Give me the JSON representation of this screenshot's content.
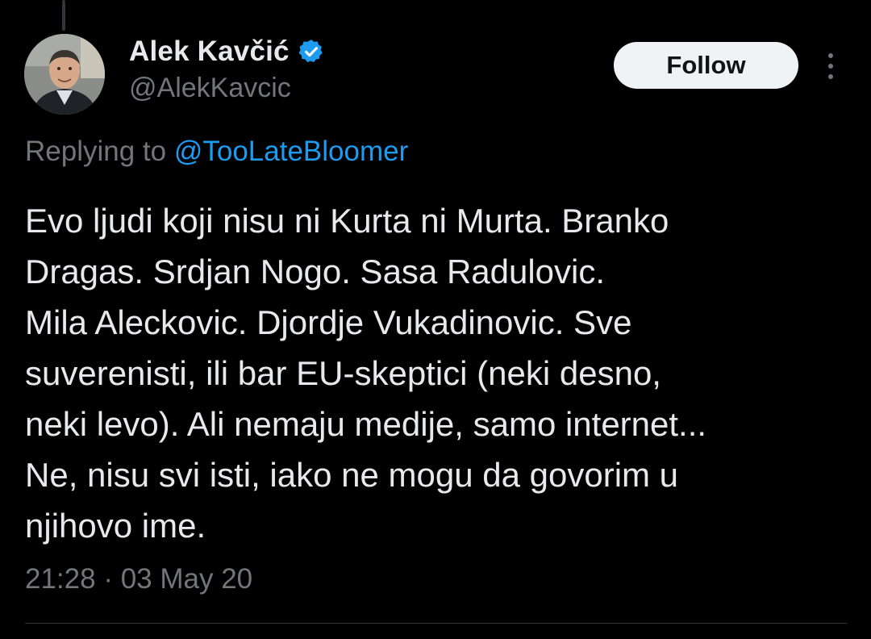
{
  "tweet": {
    "author": {
      "display_name": "Alek Kavčić",
      "handle": "@AlekKavcic",
      "verified": true,
      "avatar_icon": "profile-photo"
    },
    "follow_label": "Follow",
    "more_icon": "more-options-icon",
    "reply_prefix": "Replying to",
    "reply_to": "@TooLateBloomer",
    "text": "Evo ljudi koji nisu ni Kurta ni Murta. Branko\nDragas. Srdjan Nogo. Sasa Radulovic.\nMila Aleckovic. Djordje Vukadinovic. Sve\nsuverenisti, ili bar EU-skeptici (neki desno,\nneki levo). Ali nemaju medije, samo internet...\nNe, nisu svi isti, iako ne mogu da govorim u\nnjihovo ime.",
    "time": "21:28",
    "separator": "·",
    "date": "03 May 20"
  },
  "colors": {
    "background": "#000000",
    "primary_text": "#e7e9ea",
    "secondary_text": "#71767b",
    "link": "#1d9bf0",
    "verified_badge": "#1d9bf0",
    "follow_bg": "#eff3f4",
    "follow_text": "#0f1419",
    "divider": "#2f3336"
  }
}
